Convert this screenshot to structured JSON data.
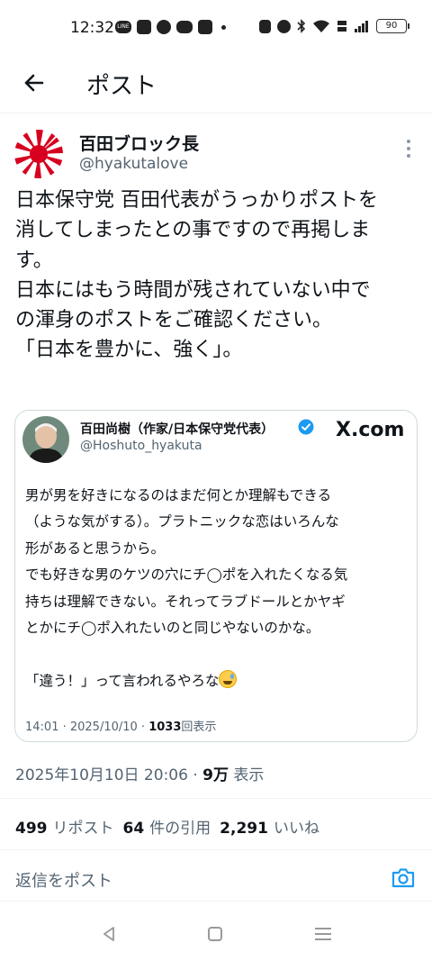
{
  "status_bar": {
    "time": "12:32",
    "battery": "90",
    "app_icon_label": "LINE"
  },
  "header": {
    "title": "ポスト"
  },
  "post": {
    "author_name": "百田ブロック長",
    "author_handle": "@hyakutalove",
    "text": "日本保守党 百田代表がうっかりポストを\n消してしまったとの事ですので再掲しま\nす。\n日本にはもう時間が残されていない中で\nの渾身のポストをご確認ください。\n「日本を豊かに、強く」。",
    "timestamp": "2025年10月10日 20:06",
    "views_count": "9万",
    "views_label": "表示"
  },
  "quote": {
    "author_name": "百田尚樹（作家/日本保守党代表）",
    "author_handle": "@Hoshuto_hyakuta",
    "source_logo": "X.com",
    "text": "男が男を好きになるのはまだ何とか理解もできる\n（ような気がする）。プラトニックな恋はいろんな\n形があると思うから。\nでも好きな男のケツの穴にチ◯ポを入れたくなる気\n持ちは理解できない。それってラブドールとかヤギ\nとかにチ◯ポ入れたいのと同じやないのかな。\n\n「違う！」って言われるやろな",
    "date": "14:01 · 2025/10/10 · ",
    "views_count": "1033",
    "views_label": "回表示"
  },
  "stats": {
    "reposts_count": "499",
    "reposts_label": "リポスト",
    "quotes_count": "64",
    "quotes_label": "件の引用",
    "likes_count": "2,291",
    "likes_label": "いいね"
  },
  "reply": {
    "placeholder": "返信をポスト"
  },
  "colors": {
    "text_primary": "#0f1419",
    "text_secondary": "#536471",
    "accent": "#1d9bf0",
    "border": "#cfd9de"
  },
  "icons": {
    "back": "arrow-left-icon",
    "more": "more-vertical-icon",
    "verified": "verified-badge-icon",
    "camera": "camera-icon"
  }
}
